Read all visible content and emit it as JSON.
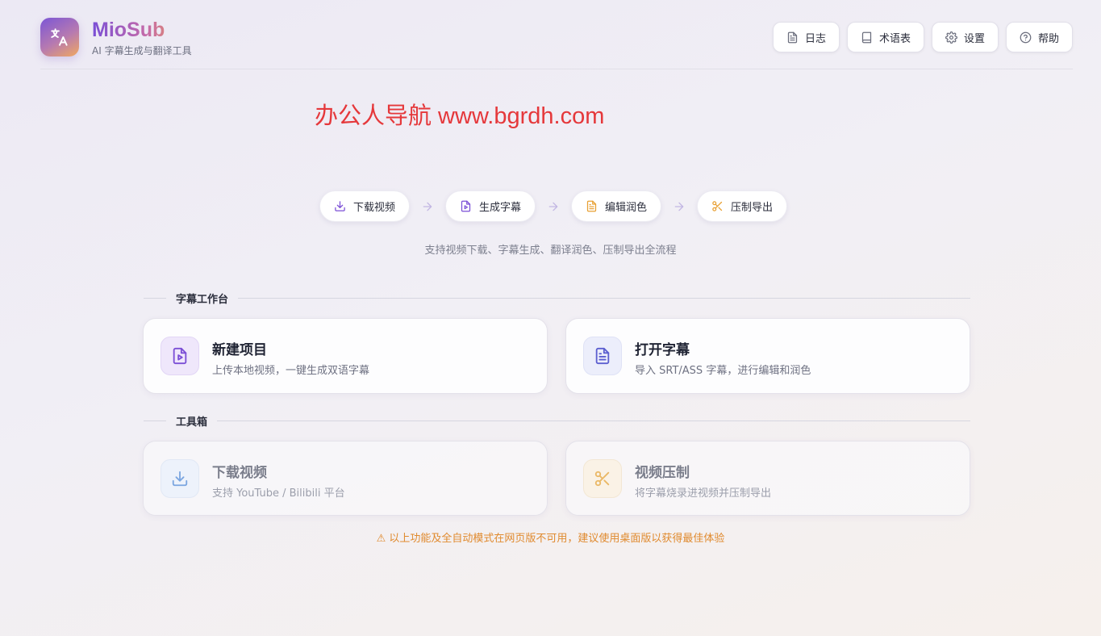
{
  "app": {
    "name": "MioSub",
    "subtitle": "AI 字幕生成与翻译工具"
  },
  "nav": [
    {
      "label": "日志",
      "icon": "file-text-icon"
    },
    {
      "label": "术语表",
      "icon": "book-icon"
    },
    {
      "label": "设置",
      "icon": "gear-icon"
    },
    {
      "label": "帮助",
      "icon": "help-circle-icon"
    }
  ],
  "watermark": "办公人导航 www.bgrdh.com",
  "steps": [
    {
      "label": "下载视频",
      "icon": "download-icon",
      "color": "#7b4fd6"
    },
    {
      "label": "生成字幕",
      "icon": "file-video-icon",
      "color": "#7b4fd6"
    },
    {
      "label": "编辑润色",
      "icon": "file-text-icon",
      "color": "#e8a033"
    },
    {
      "label": "压制导出",
      "icon": "scissors-icon",
      "color": "#e8a033"
    }
  ],
  "tagline": "支持视频下载、字幕生成、翻译润色、压制导出全流程",
  "workbench": {
    "title": "字幕工作台",
    "cards": [
      {
        "title": "新建项目",
        "desc": "上传本地视频，一键生成双语字幕",
        "icon": "file-video-icon"
      },
      {
        "title": "打开字幕",
        "desc": "导入 SRT/ASS 字幕，进行编辑和润色",
        "icon": "file-text-icon"
      }
    ]
  },
  "toolbox": {
    "title": "工具箱",
    "cards": [
      {
        "title": "下载视频",
        "desc": "支持 YouTube / Bilibili 平台",
        "icon": "download-icon"
      },
      {
        "title": "视频压制",
        "desc": "将字幕烧录进视频并压制导出",
        "icon": "scissors-icon"
      }
    ]
  },
  "warning": "⚠ 以上功能及全自动模式在网页版不可用，建议使用桌面版以获得最佳体验",
  "colors": {
    "accent_purple": "#7b4fd6",
    "accent_orange": "#e8a033",
    "warning": "#e08a2e"
  }
}
